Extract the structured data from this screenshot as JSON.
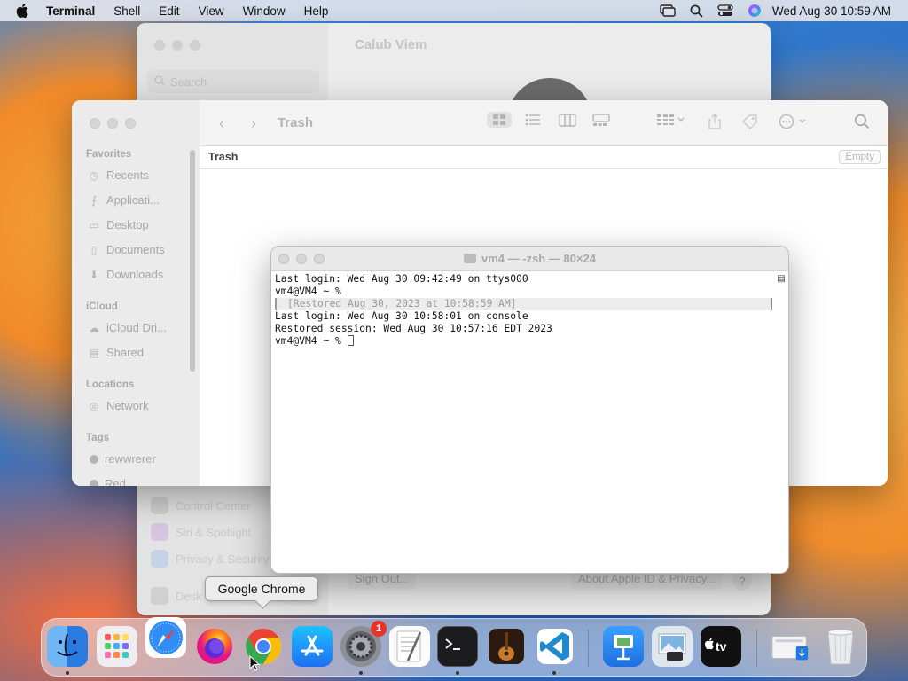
{
  "menubar": {
    "app_name": "Terminal",
    "items": [
      "Shell",
      "Edit",
      "View",
      "Window",
      "Help"
    ],
    "clock": "Wed Aug 30  10:59 AM"
  },
  "settings_window": {
    "title": "Calub Viem",
    "search_placeholder": "Search",
    "items": [
      "Control Center",
      "Siri & Spotlight",
      "Privacy & Security",
      "Desk"
    ],
    "sign_out": "Sign Out...",
    "about_apple_id": "About Apple ID & Privacy...",
    "help": "?"
  },
  "finder": {
    "title": "Trash",
    "path_label": "Trash",
    "empty_button": "Empty",
    "sections": {
      "favorites": "Favorites",
      "icloud": "iCloud",
      "locations": "Locations",
      "tags": "Tags"
    },
    "favorites": [
      "Recents",
      "Applicati...",
      "Desktop",
      "Documents",
      "Downloads"
    ],
    "icloud": [
      "iCloud Dri...",
      "Shared"
    ],
    "locations": [
      "Network"
    ],
    "tags": [
      "rewwrerer",
      "Red"
    ]
  },
  "terminal": {
    "title": "vm4 — -zsh — 80×24",
    "lines": [
      "Last login: Wed Aug 30 09:42:49 on ttys000",
      "vm4@VM4 ~ %",
      "[Restored Aug 30, 2023 at 10:58:59 AM]",
      "Last login: Wed Aug 30 10:58:01 on console",
      "Restored session: Wed Aug 30 10:57:16 EDT 2023",
      "vm4@VM4 ~ % "
    ]
  },
  "tooltip": "Google Chrome",
  "dock": {
    "system_settings_badge": "1",
    "tv_label": "tv",
    "icons": [
      "finder-icon",
      "launchpad-icon",
      "safari-icon",
      "firefox-icon",
      "chrome-icon",
      "app-store-icon",
      "system-settings-icon",
      "textedit-icon",
      "terminal-icon",
      "garageband-icon",
      "vscode-icon",
      "keynote-icon",
      "preview-icon",
      "apple-tv-icon",
      "downloads-stack-icon",
      "trash-icon"
    ]
  }
}
